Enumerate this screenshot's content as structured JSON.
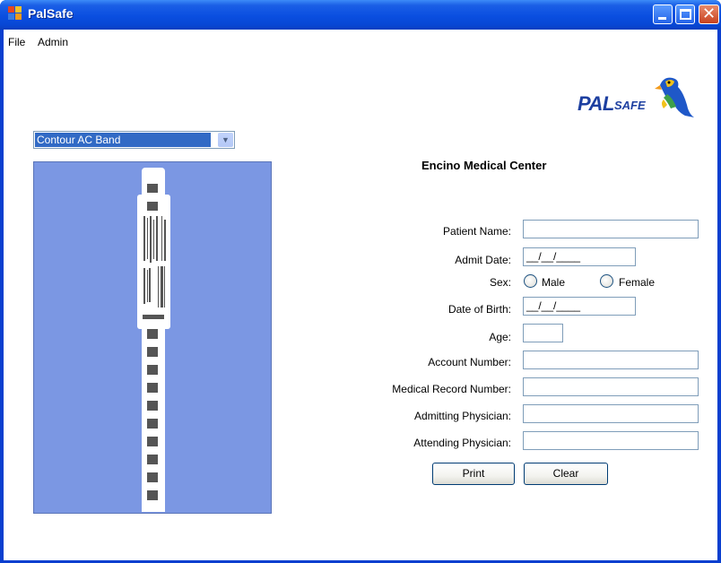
{
  "window": {
    "title": "PalSafe",
    "colors": {
      "titlebar": "#0a4ee0",
      "client": "#ffffff",
      "selection": "#316ac5",
      "preview_bg": "#7b97e3"
    }
  },
  "menu": {
    "file": "File",
    "admin": "Admin"
  },
  "logo": {
    "pal": "PAL",
    "safe": "SAFE"
  },
  "band_select": {
    "value": "Contour AC Band"
  },
  "form": {
    "center_name": "Encino Medical Center",
    "labels": {
      "patient_name": "Patient Name:",
      "admit_date": "Admit Date:",
      "sex": "Sex:",
      "dob": "Date of Birth:",
      "age": "Age:",
      "account": "Account Number:",
      "mrn": "Medical Record Number:",
      "admitting": "Admitting Physician:",
      "attending": "Attending Physician:"
    },
    "values": {
      "patient_name": "",
      "admit_date": "__/__/____",
      "dob": "__/__/____",
      "age": "",
      "account": "",
      "mrn": "",
      "admitting": "",
      "attending": ""
    },
    "sex_options": {
      "male": "Male",
      "female": "Female"
    },
    "buttons": {
      "print": "Print",
      "clear": "Clear"
    }
  },
  "icons": {
    "app": "palsafe-app-icon",
    "minimize": "minimize-icon",
    "maximize": "maximize-icon",
    "close": "close-icon",
    "dropdown": "chevron-down-icon",
    "logo_bird": "parrot-icon"
  }
}
